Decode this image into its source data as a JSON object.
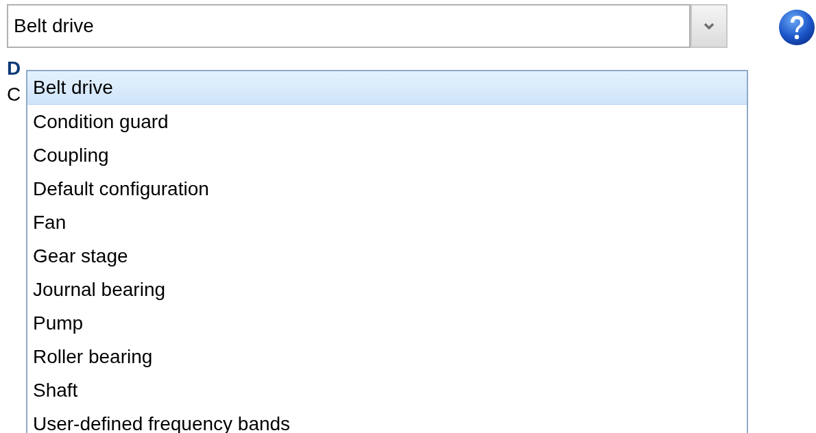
{
  "select": {
    "value": "Belt drive"
  },
  "description": {
    "label": "D",
    "value": "C"
  },
  "dropdown": {
    "options": [
      {
        "label": "Belt drive",
        "selected": true
      },
      {
        "label": "Condition guard",
        "selected": false
      },
      {
        "label": "Coupling",
        "selected": false
      },
      {
        "label": "Default configuration",
        "selected": false
      },
      {
        "label": "Fan",
        "selected": false
      },
      {
        "label": "Gear stage",
        "selected": false
      },
      {
        "label": "Journal bearing",
        "selected": false
      },
      {
        "label": "Pump",
        "selected": false
      },
      {
        "label": "Roller bearing",
        "selected": false
      },
      {
        "label": "Shaft",
        "selected": false
      },
      {
        "label": "User-defined frequency bands",
        "selected": false
      }
    ]
  }
}
